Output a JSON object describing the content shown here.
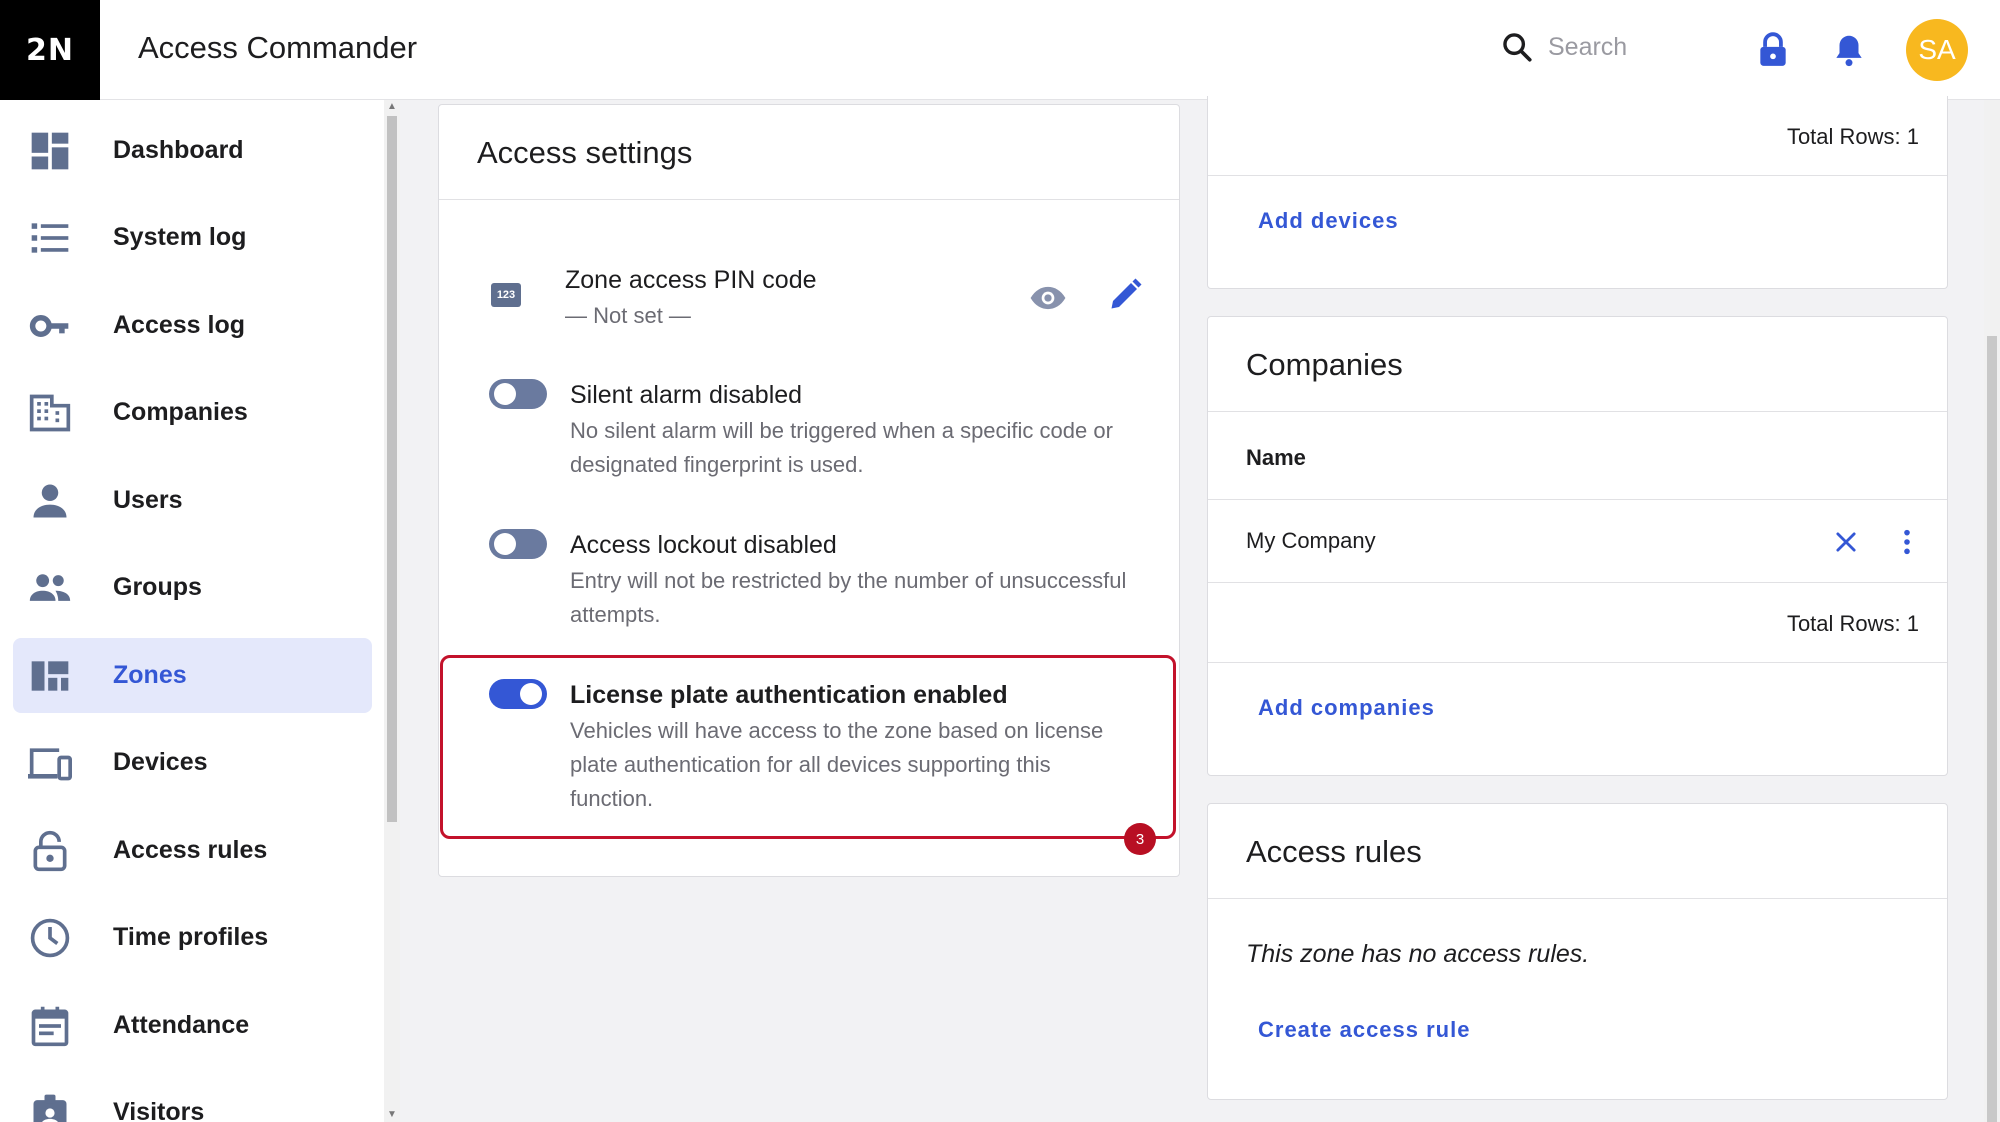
{
  "header": {
    "logo": "2N",
    "title": "Access Commander",
    "search_placeholder": "Search",
    "avatar_initials": "SA"
  },
  "sidebar": {
    "items": [
      {
        "label": "Dashboard",
        "icon": "dashboard-icon"
      },
      {
        "label": "System log",
        "icon": "list-icon"
      },
      {
        "label": "Access log",
        "icon": "key-icon"
      },
      {
        "label": "Companies",
        "icon": "building-icon"
      },
      {
        "label": "Users",
        "icon": "user-icon"
      },
      {
        "label": "Groups",
        "icon": "group-icon"
      },
      {
        "label": "Zones",
        "icon": "zones-icon",
        "active": true
      },
      {
        "label": "Devices",
        "icon": "devices-icon"
      },
      {
        "label": "Access rules",
        "icon": "lock-open-icon"
      },
      {
        "label": "Time profiles",
        "icon": "clock-icon"
      },
      {
        "label": "Attendance",
        "icon": "calendar-icon"
      },
      {
        "label": "Visitors",
        "icon": "visitor-badge-icon"
      }
    ]
  },
  "access_settings": {
    "title": "Access settings",
    "pin": {
      "title": "Zone access PIN code",
      "value": "— Not set —",
      "icon_label": "123"
    },
    "silent_alarm": {
      "title": "Silent alarm disabled",
      "description": "No silent alarm will be triggered when a specific code or designated fingerprint is used.",
      "enabled": false
    },
    "lockout": {
      "title": "Access lockout disabled",
      "description": "Entry will not be restricted by the number of unsuccessful attempts.",
      "enabled": false
    },
    "license_plate": {
      "title": "License plate authentication enabled",
      "description": "Vehicles will have access to the zone based on license plate authentication for all devices supporting this function.",
      "enabled": true
    },
    "step_badge": "3"
  },
  "devices": {
    "total_rows": "Total Rows: 1",
    "add_label": "Add devices"
  },
  "companies": {
    "title": "Companies",
    "column_name": "Name",
    "rows": [
      {
        "name": "My Company"
      }
    ],
    "total_rows": "Total Rows: 1",
    "add_label": "Add companies"
  },
  "access_rules": {
    "title": "Access rules",
    "empty_message": "This zone has no access rules.",
    "create_label": "Create access rule"
  },
  "colors": {
    "accent": "#3457d5",
    "highlight": "#c3122b",
    "avatar": "#f8b81f"
  }
}
